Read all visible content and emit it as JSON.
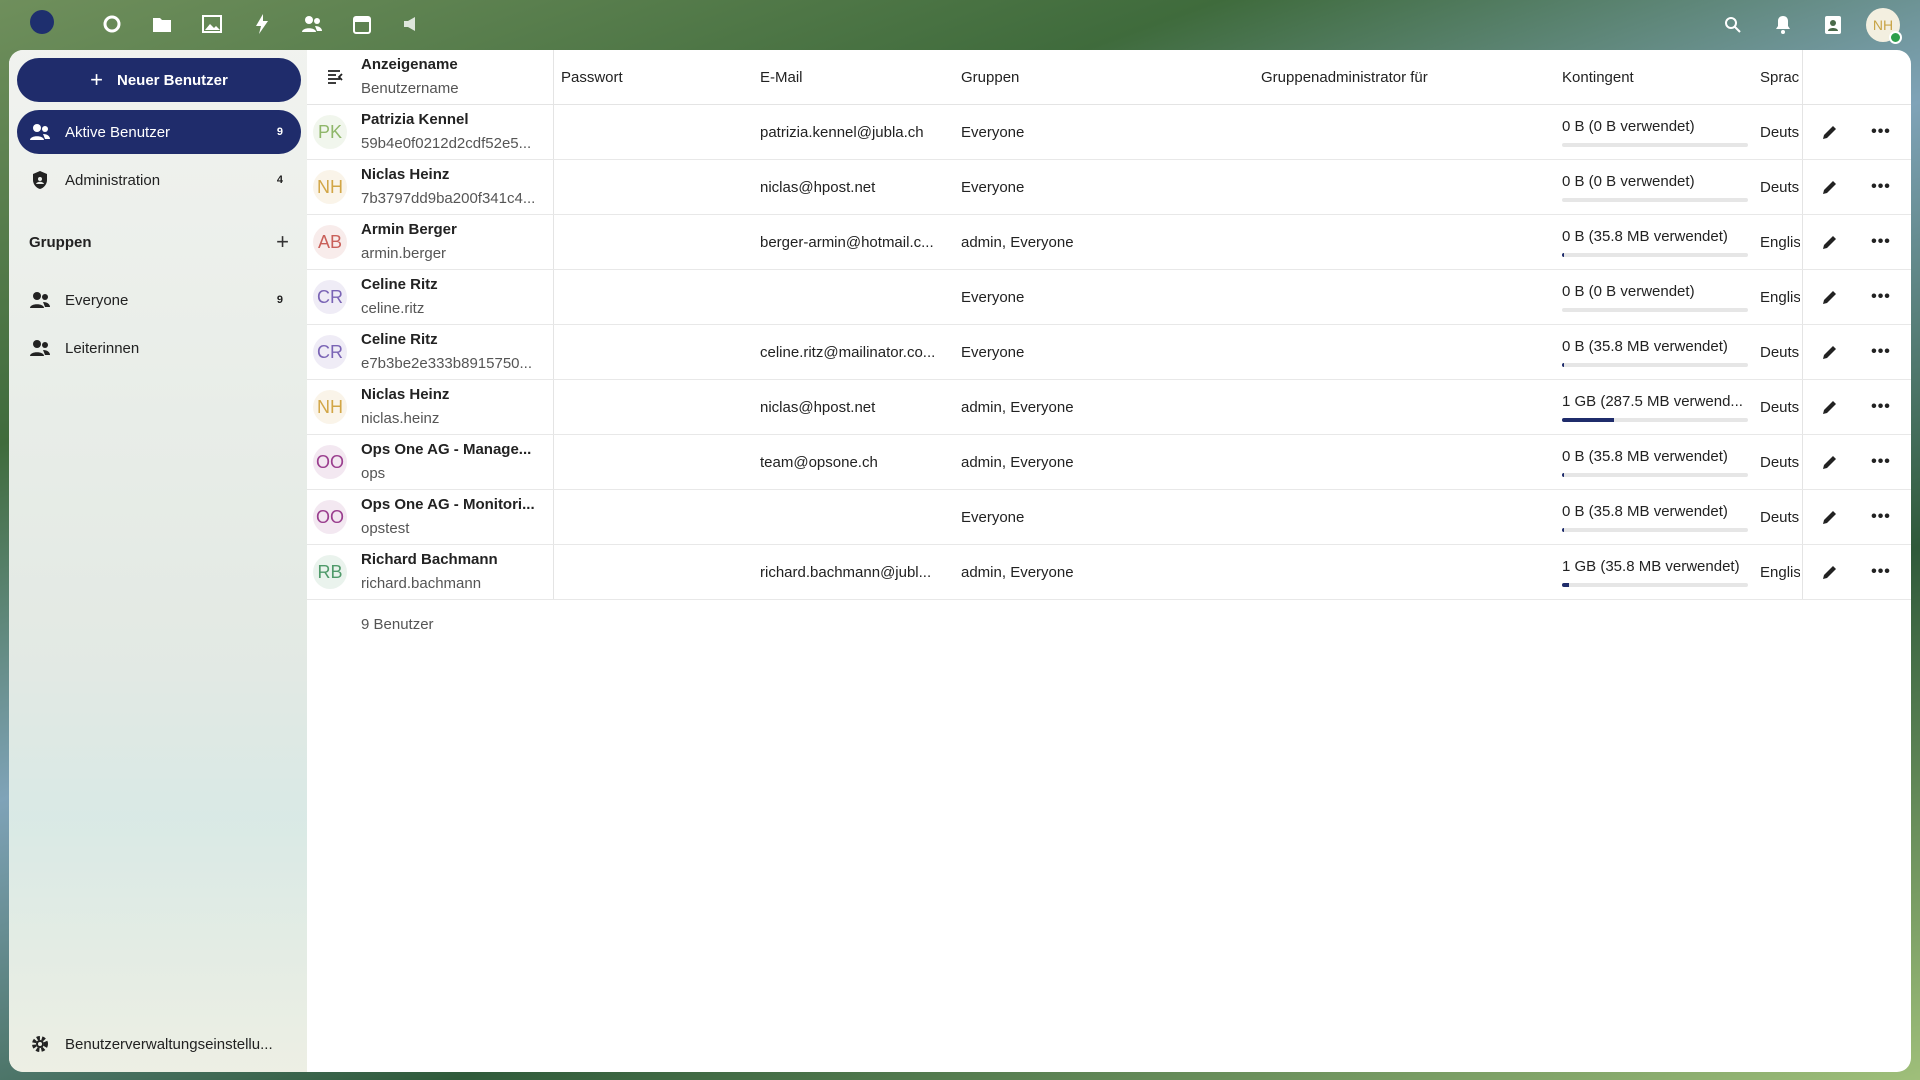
{
  "topbar": {
    "apps": [
      "dashboard-icon",
      "files-icon",
      "photos-icon",
      "activity-icon",
      "contacts-icon",
      "calendar-icon",
      "announcements-icon"
    ],
    "avatar_initials": "NH"
  },
  "sidebar": {
    "new_user_label": "Neuer Benutzer",
    "items": [
      {
        "label": "Aktive Benutzer",
        "count": "9"
      },
      {
        "label": "Administration",
        "count": "4"
      }
    ],
    "groups_label": "Gruppen",
    "groups": [
      {
        "label": "Everyone",
        "count": "9"
      },
      {
        "label": "Leiterinnen",
        "count": ""
      }
    ],
    "settings_label": "Benutzerverwaltungseinstellu..."
  },
  "table": {
    "headers": {
      "display_name": "Anzeigename",
      "username": "Benutzername",
      "password": "Passwort",
      "email": "E-Mail",
      "groups": "Gruppen",
      "group_admin": "Gruppenadministrator für",
      "quota": "Kontingent",
      "language": "Sprac"
    },
    "rows": [
      {
        "initials": "PK",
        "color": "#8fb76a",
        "name": "Patrizia Kennel",
        "user": "59b4e0f0212d2cdf52e5...",
        "email": "patrizia.kennel@jubla.ch",
        "groups": "Everyone",
        "quota": "0 B (0 B verwendet)",
        "quota_fill": 0,
        "lang": "Deuts"
      },
      {
        "initials": "NH",
        "color": "#d2a646",
        "name": "Niclas Heinz",
        "user": "7b3797dd9ba200f341c4...",
        "email": "niclas@hpost.net",
        "groups": "Everyone",
        "quota": "0 B (0 B verwendet)",
        "quota_fill": 0,
        "lang": "Deuts"
      },
      {
        "initials": "AB",
        "color": "#c9605a",
        "name": "Armin Berger",
        "user": "armin.berger",
        "email": "berger-armin@hotmail.c...",
        "groups": "admin, Everyone",
        "quota": "0 B (35.8 MB verwendet)",
        "quota_fill": 0.01,
        "lang": "Englis"
      },
      {
        "initials": "CR",
        "color": "#7a64b5",
        "name": "Celine Ritz",
        "user": "celine.ritz",
        "email": "",
        "groups": "Everyone",
        "quota": "0 B (0 B verwendet)",
        "quota_fill": 0,
        "lang": "Englis"
      },
      {
        "initials": "CR",
        "color": "#7a64b5",
        "name": "Celine Ritz",
        "user": "e7b3be2e333b8915750...",
        "email": "celine.ritz@mailinator.co...",
        "groups": "Everyone",
        "quota": "0 B (35.8 MB verwendet)",
        "quota_fill": 0.01,
        "lang": "Deuts"
      },
      {
        "initials": "NH",
        "color": "#d2a646",
        "name": "Niclas Heinz",
        "user": "niclas.heinz",
        "email": "niclas@hpost.net",
        "groups": "admin, Everyone",
        "quota": "1 GB (287.5 MB verwend...",
        "quota_fill": 0.28,
        "lang": "Deuts"
      },
      {
        "initials": "OO",
        "color": "#9a3e8e",
        "name": "Ops One AG - Manage...",
        "user": "ops",
        "email": "team@opsone.ch",
        "groups": "admin, Everyone",
        "quota": "0 B (35.8 MB verwendet)",
        "quota_fill": 0.01,
        "lang": "Deuts"
      },
      {
        "initials": "OO",
        "color": "#9a3e8e",
        "name": "Ops One AG - Monitori...",
        "user": "opstest",
        "email": "",
        "groups": "Everyone",
        "quota": "0 B (35.8 MB verwendet)",
        "quota_fill": 0.01,
        "lang": "Deuts"
      },
      {
        "initials": "RB",
        "color": "#4f9a6a",
        "name": "Richard Bachmann",
        "user": "richard.bachmann",
        "email": "richard.bachmann@jubl...",
        "groups": "admin, Everyone",
        "quota": "1 GB (35.8 MB verwendet)",
        "quota_fill": 0.035,
        "lang": "Englis"
      }
    ],
    "footer": "9 Benutzer"
  }
}
